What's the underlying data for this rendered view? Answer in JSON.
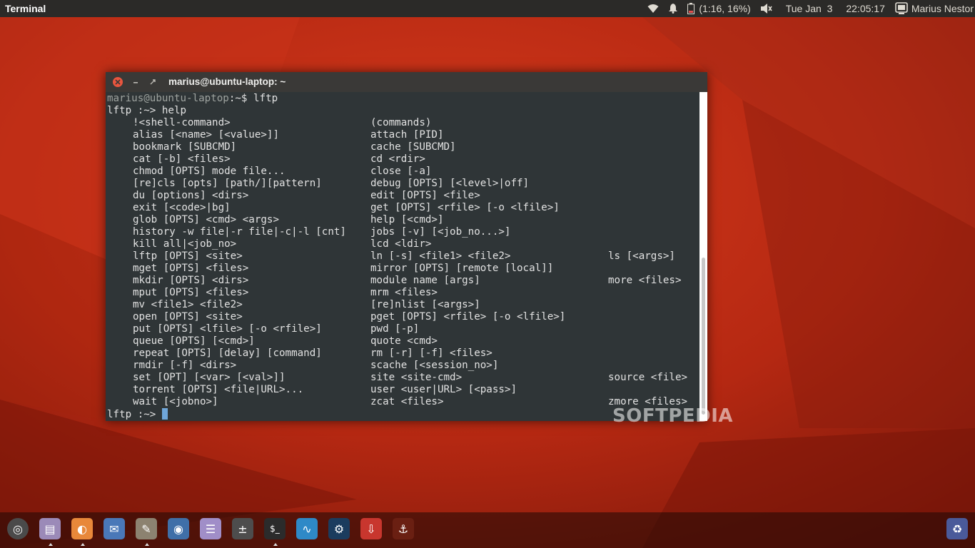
{
  "top_panel": {
    "app_title": "Terminal",
    "battery_text": "(1:16, 16%)",
    "date": "Tue Jan  3",
    "time": "22:05:17",
    "user": "Marius Nestor",
    "icons": [
      "wifi-icon",
      "bell-icon",
      "battery-icon",
      "volume-icon",
      "user-icon"
    ]
  },
  "terminal": {
    "title": "marius@ubuntu-laptop: ~",
    "prompt_line": {
      "user": "marius@ubuntu-laptop",
      "rest": ":~$ lftp"
    },
    "help_line": "lftp :~> help",
    "final_prompt": "lftp :~> ",
    "rows": [
      [
        "!<shell-command>",
        "(commands)",
        ""
      ],
      [
        "alias [<name> [<value>]]",
        "attach [PID]",
        ""
      ],
      [
        "bookmark [SUBCMD]",
        "cache [SUBCMD]",
        ""
      ],
      [
        "cat [-b] <files>",
        "cd <rdir>",
        ""
      ],
      [
        "chmod [OPTS] mode file...",
        "close [-a]",
        ""
      ],
      [
        "[re]cls [opts] [path/][pattern]",
        "debug [OPTS] [<level>|off]",
        ""
      ],
      [
        "du [options] <dirs>",
        "edit [OPTS] <file>",
        ""
      ],
      [
        "exit [<code>|bg]",
        "get [OPTS] <rfile> [-o <lfile>]",
        ""
      ],
      [
        "glob [OPTS] <cmd> <args>",
        "help [<cmd>]",
        ""
      ],
      [
        "history -w file|-r file|-c|-l [cnt]",
        "jobs [-v] [<job_no...>]",
        ""
      ],
      [
        "kill all|<job_no>",
        "lcd <ldir>",
        ""
      ],
      [
        "lftp [OPTS] <site>",
        "ln [-s] <file1> <file2>",
        "ls [<args>]"
      ],
      [
        "mget [OPTS] <files>",
        "mirror [OPTS] [remote [local]]",
        ""
      ],
      [
        "mkdir [OPTS] <dirs>",
        "module name [args]",
        "more <files>"
      ],
      [
        "mput [OPTS] <files>",
        "mrm <files>",
        ""
      ],
      [
        "mv <file1> <file2>",
        "[re]nlist [<args>]",
        ""
      ],
      [
        "open [OPTS] <site>",
        "pget [OPTS] <rfile> [-o <lfile>]",
        ""
      ],
      [
        "put [OPTS] <lfile> [-o <rfile>]",
        "pwd [-p]",
        ""
      ],
      [
        "queue [OPTS] [<cmd>]",
        "quote <cmd>",
        ""
      ],
      [
        "repeat [OPTS] [delay] [command]",
        "rm [-r] [-f] <files>",
        ""
      ],
      [
        "rmdir [-f] <dirs>",
        "scache [<session_no>]",
        ""
      ],
      [
        "set [OPT] [<var> [<val>]]",
        "site <site-cmd>",
        "source <file>"
      ],
      [
        "torrent [OPTS] <file|URL>...",
        "user <user|URL> [<pass>]",
        ""
      ],
      [
        "wait [<jobno>]",
        "zcat <files>",
        "zmore <files>"
      ]
    ]
  },
  "watermark": "SOFTPEDIA",
  "dock": {
    "items": [
      {
        "name": "ubuntu-logo-icon",
        "color": "#4a4a4a",
        "glyph": "◎"
      },
      {
        "name": "files-icon",
        "color": "#9b8ab8",
        "glyph": "▤"
      },
      {
        "name": "firefox-icon",
        "color": "#e8883a",
        "glyph": "◐"
      },
      {
        "name": "mail-icon",
        "color": "#4a78b8",
        "glyph": "✉"
      },
      {
        "name": "gimp-icon",
        "color": "#8c8270",
        "glyph": "✎"
      },
      {
        "name": "screenshot-icon",
        "color": "#3f6fa8",
        "glyph": "◉"
      },
      {
        "name": "text-editor-icon",
        "color": "#a08ec8",
        "glyph": "☰"
      },
      {
        "name": "calculator-icon",
        "color": "#4d4d4d",
        "glyph": "±"
      },
      {
        "name": "terminal-icon",
        "color": "#2b2b2b",
        "glyph": "$_"
      },
      {
        "name": "system-monitor-icon",
        "color": "#2e89c7",
        "glyph": "∿"
      },
      {
        "name": "steam-icon",
        "color": "#1b3c5e",
        "glyph": "⚙"
      },
      {
        "name": "software-center-icon",
        "color": "#c8362e",
        "glyph": "⇩"
      },
      {
        "name": "transmission-icon",
        "color": "#6a1f12",
        "glyph": "⚓"
      },
      {
        "name": "trash-icon",
        "color": "#4a5a9a",
        "glyph": "♻"
      }
    ]
  }
}
